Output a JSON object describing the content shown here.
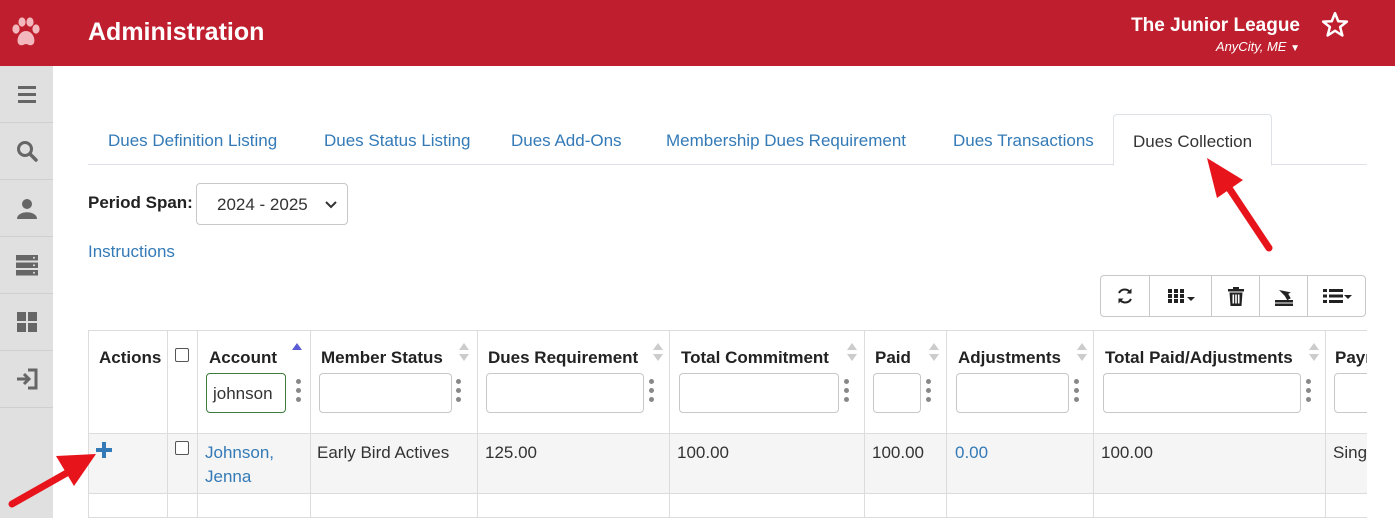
{
  "header": {
    "title": "Administration",
    "org_name": "The Junior League",
    "org_city": "AnyCity, ME",
    "brand_color": "#be1e2d"
  },
  "sidebar": {
    "items": [
      {
        "icon": "menu-icon"
      },
      {
        "icon": "search-icon"
      },
      {
        "icon": "user-icon"
      },
      {
        "icon": "server-icon"
      },
      {
        "icon": "dashboard-icon"
      },
      {
        "icon": "logout-icon"
      }
    ]
  },
  "tabs": [
    {
      "label": "Dues Definition Listing"
    },
    {
      "label": "Dues Status Listing"
    },
    {
      "label": "Dues Add-Ons"
    },
    {
      "label": "Membership Dues Requirement"
    },
    {
      "label": "Dues Transactions"
    },
    {
      "label": "Dues Collection",
      "active": true
    }
  ],
  "period": {
    "label": "Period Span:",
    "value": "2024 - 2025"
  },
  "instructions_label": "Instructions",
  "toolbar": {
    "buttons": [
      "refresh-icon",
      "columns-icon",
      "trash-icon",
      "export-icon",
      "list-icon"
    ]
  },
  "table": {
    "columns": [
      {
        "label": "Actions"
      },
      {
        "label": ""
      },
      {
        "label": "Account",
        "filter": "johnson"
      },
      {
        "label": "Member Status",
        "filter": ""
      },
      {
        "label": "Dues Requirement",
        "filter": ""
      },
      {
        "label": "Total Commitment",
        "filter": ""
      },
      {
        "label": "Paid",
        "filter": ""
      },
      {
        "label": "Adjustments",
        "filter": ""
      },
      {
        "label": "Total Paid/Adjustments",
        "filter": ""
      },
      {
        "label": "Payı",
        "filter": ""
      }
    ],
    "rows": [
      {
        "account_line1": "Johnson,",
        "account_line2": "Jenna",
        "member_status": "Early Bird Actives",
        "dues_requirement": "125.00",
        "total_commitment": "100.00",
        "paid": "100.00",
        "adjustments": "0.00",
        "total_paid_adjustments": "100.00",
        "payment": "Singl"
      }
    ]
  }
}
